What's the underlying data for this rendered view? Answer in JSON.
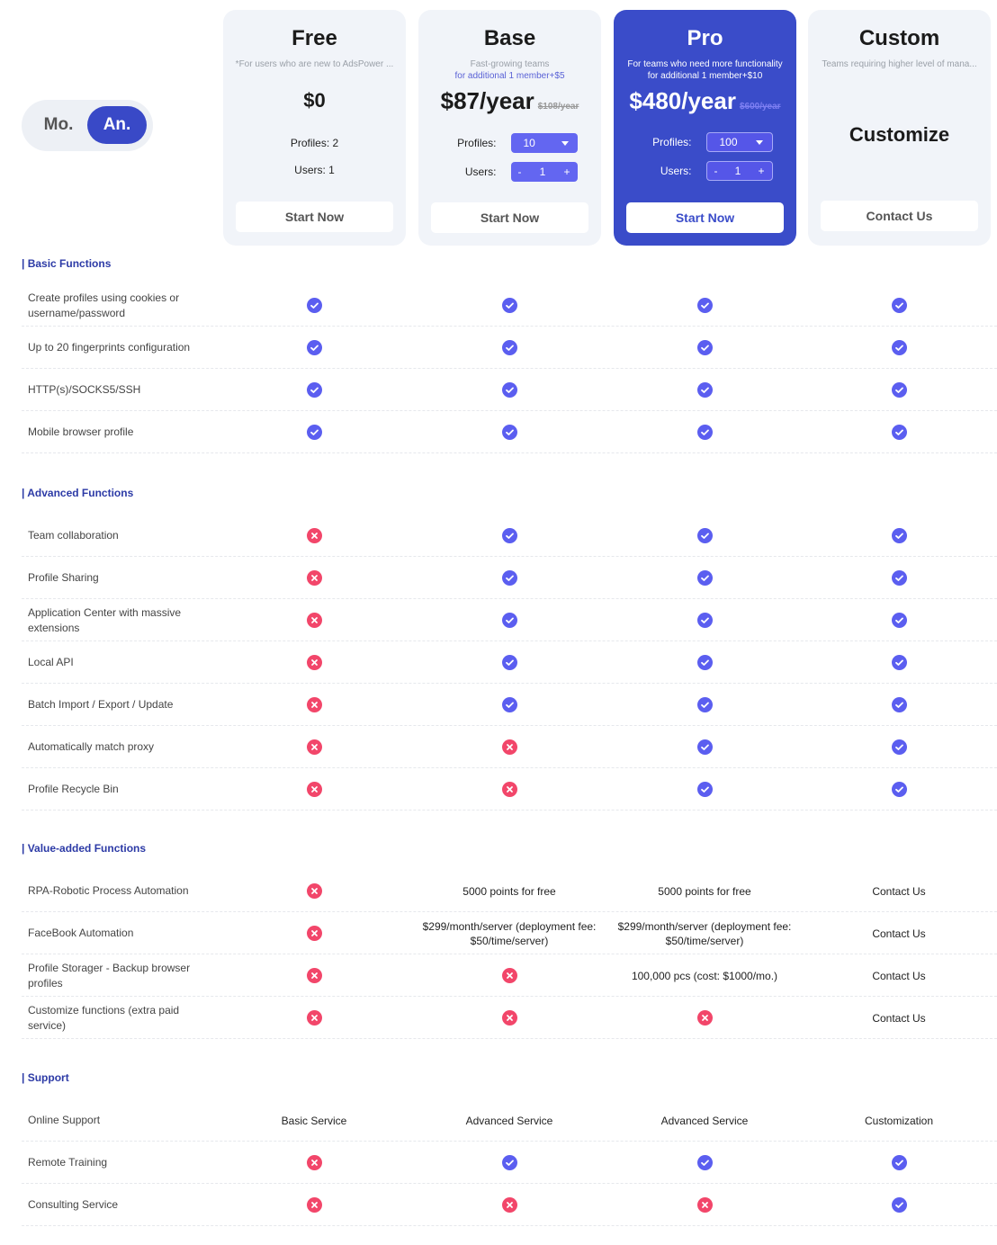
{
  "billing_toggle": {
    "monthly_label": "Mo.",
    "annual_label": "An.",
    "selected": "annual"
  },
  "colors": {
    "primary": "#3a4cc9",
    "check": "#5b5ef0",
    "cross": "#f2466a",
    "section_title": "#2c3aa6",
    "card_bg": "#f1f4f9"
  },
  "plans": [
    {
      "name": "Free",
      "description": "*For users who are new to AdsPower ...",
      "price": "$0",
      "profiles_text": "Profiles: 2",
      "users_text": "Users: 1",
      "button": "Start Now"
    },
    {
      "name": "Base",
      "description": "Fast-growing teams",
      "extra": "for additional 1 member+$5",
      "price": "$87/year",
      "old_price": "$108/year",
      "profiles_label": "Profiles:",
      "profiles_value": "10",
      "users_label": "Users:",
      "users_value": "1",
      "minus": "-",
      "plus": "+",
      "button": "Start Now"
    },
    {
      "name": "Pro",
      "description": "For teams who need more functionality",
      "extra": "for additional 1 member+$10",
      "price": "$480/year",
      "old_price": "$600/year",
      "profiles_label": "Profiles:",
      "profiles_value": "100",
      "users_label": "Users:",
      "users_value": "1",
      "minus": "-",
      "plus": "+",
      "button": "Start Now"
    },
    {
      "name": "Custom",
      "description": "Teams requiring higher level of mana...",
      "price": "Customize",
      "button": "Contact Us"
    }
  ],
  "sections": [
    {
      "title": "Basic Functions",
      "rows": [
        {
          "label": "Create profiles using cookies or username/password",
          "cells": [
            "yes",
            "yes",
            "yes",
            "yes"
          ]
        },
        {
          "label": "Up to 20 fingerprints configuration",
          "cells": [
            "yes",
            "yes",
            "yes",
            "yes"
          ]
        },
        {
          "label": "HTTP(s)/SOCKS5/SSH",
          "cells": [
            "yes",
            "yes",
            "yes",
            "yes"
          ]
        },
        {
          "label": "Mobile browser profile",
          "cells": [
            "yes",
            "yes",
            "yes",
            "yes"
          ]
        }
      ]
    },
    {
      "title": "Advanced Functions",
      "rows": [
        {
          "label": "Team collaboration",
          "cells": [
            "no",
            "yes",
            "yes",
            "yes"
          ]
        },
        {
          "label": "Profile Sharing",
          "cells": [
            "no",
            "yes",
            "yes",
            "yes"
          ]
        },
        {
          "label": "Application Center with massive extensions",
          "cells": [
            "no",
            "yes",
            "yes",
            "yes"
          ]
        },
        {
          "label": "Local API",
          "cells": [
            "no",
            "yes",
            "yes",
            "yes"
          ]
        },
        {
          "label": "Batch Import / Export / Update",
          "cells": [
            "no",
            "yes",
            "yes",
            "yes"
          ]
        },
        {
          "label": "Automatically match proxy",
          "cells": [
            "no",
            "no",
            "yes",
            "yes"
          ]
        },
        {
          "label": "Profile Recycle Bin",
          "cells": [
            "no",
            "no",
            "yes",
            "yes"
          ]
        }
      ]
    },
    {
      "title": "Value-added Functions",
      "rows": [
        {
          "label": "RPA-Robotic Process Automation",
          "cells": [
            "no",
            "5000 points for free",
            "5000 points for free",
            "Contact Us"
          ]
        },
        {
          "label": "FaceBook Automation",
          "cells": [
            "no",
            "$299/month/server (deployment fee: $50/time/server)",
            "$299/month/server (deployment fee: $50/time/server)",
            "Contact Us"
          ]
        },
        {
          "label": "Profile Storager - Backup browser profiles",
          "cells": [
            "no",
            "no",
            "100,000 pcs  (cost: $1000/mo.)",
            "Contact Us"
          ]
        },
        {
          "label": "Customize functions (extra paid service)",
          "cells": [
            "no",
            "no",
            "no",
            "Contact Us"
          ]
        }
      ]
    },
    {
      "title": "Support",
      "rows": [
        {
          "label": "Online Support",
          "cells": [
            "Basic Service",
            "Advanced Service",
            "Advanced Service",
            "Customization"
          ]
        },
        {
          "label": "Remote Training",
          "cells": [
            "no",
            "yes",
            "yes",
            "yes"
          ]
        },
        {
          "label": "Consulting Service",
          "cells": [
            "no",
            "no",
            "no",
            "yes"
          ]
        }
      ]
    }
  ]
}
